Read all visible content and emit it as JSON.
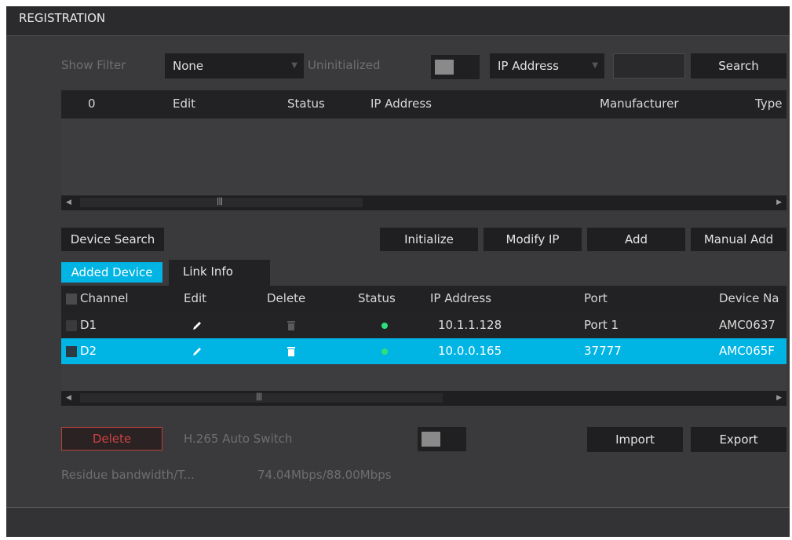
{
  "window": {
    "title": "REGISTRATION"
  },
  "filter": {
    "show_filter_label": "Show Filter",
    "show_filter_value": "None",
    "uninitialized_label": "Uninitialized",
    "search_type_value": "IP Address",
    "search_input_value": "",
    "search_button": "Search"
  },
  "search_table": {
    "columns": [
      "0",
      "Edit",
      "Status",
      "IP Address",
      "Manufacturer",
      "Type"
    ],
    "rows": []
  },
  "actions": {
    "device_search": "Device Search",
    "initialize": "Initialize",
    "modify_ip": "Modify IP",
    "add": "Add",
    "manual_add": "Manual Add"
  },
  "tabs": {
    "added_device": "Added Device",
    "link_info": "Link Info"
  },
  "added_table": {
    "columns": [
      "Channel",
      "Edit",
      "Delete",
      "Status",
      "IP Address",
      "Port",
      "Device Na"
    ],
    "rows": [
      {
        "channel": "D1",
        "status": "online",
        "ip": "10.1.1.128",
        "port": "Port 1",
        "device_name": "AMC0637",
        "selected": false
      },
      {
        "channel": "D2",
        "status": "online",
        "ip": "10.0.0.165",
        "port": "37777",
        "device_name": "AMC065F",
        "selected": true
      }
    ]
  },
  "bottom": {
    "delete": "Delete",
    "h265_label": "H.265 Auto Switch",
    "import": "Import",
    "export": "Export",
    "bandwidth_label": "Residue bandwidth/T...",
    "bandwidth_value": "74.04Mbps/88.00Mbps"
  },
  "colors": {
    "selected_row": "#00b4e4",
    "status_online": "#2de07a",
    "delete_border": "#b8403e"
  },
  "icons": {
    "edit": "pencil-icon",
    "delete": "trash-icon",
    "status": "status-dot-icon",
    "dropdown": "chevron-down-icon",
    "scroll_left": "arrow-left-icon",
    "scroll_right": "arrow-right-icon"
  }
}
